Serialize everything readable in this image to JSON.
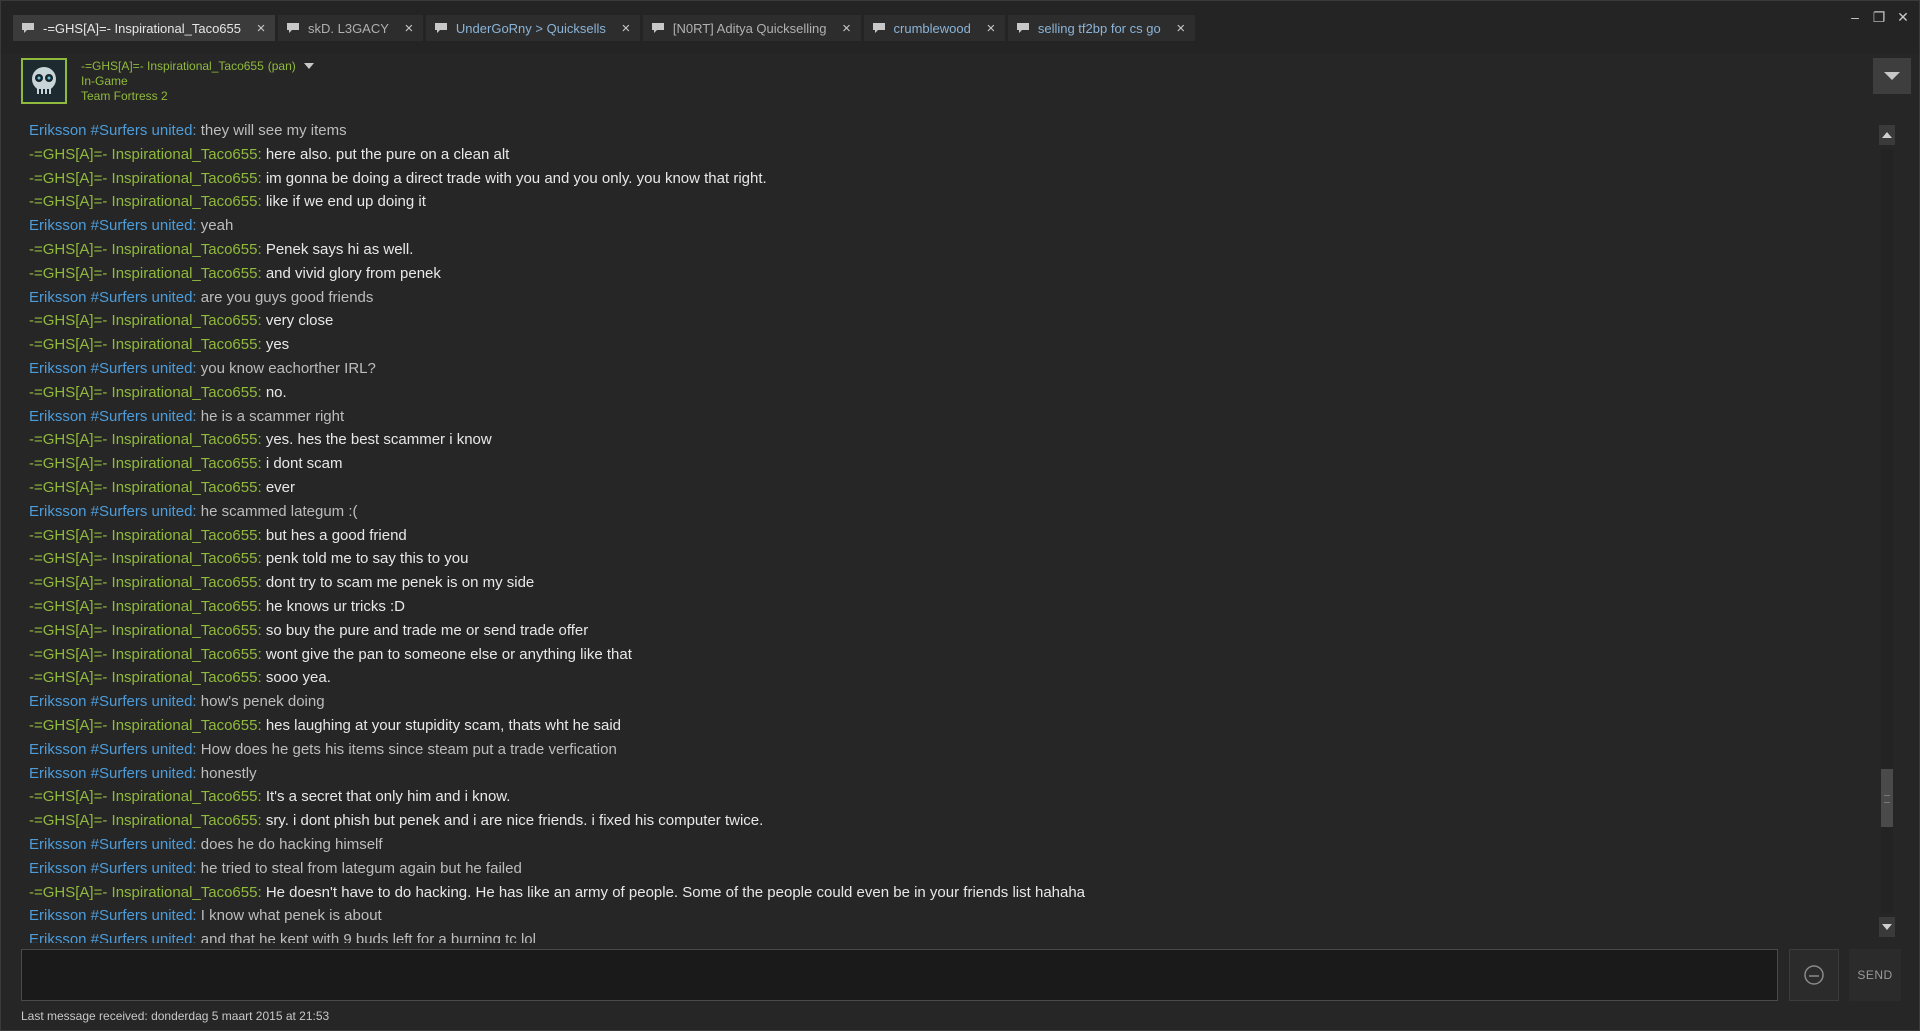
{
  "tabs": [
    {
      "label": "-=GHS[A]=- Inspirational_Taco655",
      "active": true,
      "style": "active"
    },
    {
      "label": "skD. L3GACY",
      "active": false,
      "style": "plain"
    },
    {
      "label": "UnderGoRny > Quicksells",
      "active": false,
      "style": "link"
    },
    {
      "label": "[N0RT] Aditya Quickselling",
      "active": false,
      "style": "plain"
    },
    {
      "label": "crumblewood",
      "active": false,
      "style": "link"
    },
    {
      "label": "selling tf2bp for cs go",
      "active": false,
      "style": "link"
    }
  ],
  "tab_close_glyph": "×",
  "window_controls": {
    "minimize": "–",
    "restore": "❐",
    "close": "✕"
  },
  "header": {
    "name": "-=GHS[A]=- Inspirational_Taco655",
    "name_suffix": "(pan)",
    "status": "In-Game",
    "game": "Team Fortress 2"
  },
  "colors": {
    "friend_name": "#4d9ddb",
    "self_name": "#90ba3c",
    "background": "#262626"
  },
  "messages": [
    {
      "from": "them",
      "sender": "Eriksson #Surfers united",
      "text": "they will see my items"
    },
    {
      "from": "me",
      "sender": "-=GHS[A]=- Inspirational_Taco655",
      "text": "here also. put the pure on a clean alt"
    },
    {
      "from": "me",
      "sender": "-=GHS[A]=- Inspirational_Taco655",
      "text": "im gonna be doing a direct trade with you and you only. you know that right."
    },
    {
      "from": "me",
      "sender": "-=GHS[A]=- Inspirational_Taco655",
      "text": "like if we end up doing it"
    },
    {
      "from": "them",
      "sender": "Eriksson #Surfers united",
      "text": "yeah"
    },
    {
      "from": "me",
      "sender": "-=GHS[A]=- Inspirational_Taco655",
      "text": "Penek says hi as well."
    },
    {
      "from": "me",
      "sender": "-=GHS[A]=- Inspirational_Taco655",
      "text": "and vivid glory from penek"
    },
    {
      "from": "them",
      "sender": "Eriksson #Surfers united",
      "text": "are you guys good friends"
    },
    {
      "from": "me",
      "sender": "-=GHS[A]=- Inspirational_Taco655",
      "text": "very close"
    },
    {
      "from": "me",
      "sender": "-=GHS[A]=- Inspirational_Taco655",
      "text": "yes"
    },
    {
      "from": "them",
      "sender": "Eriksson #Surfers united",
      "text": "you know eachorther IRL?"
    },
    {
      "from": "me",
      "sender": "-=GHS[A]=- Inspirational_Taco655",
      "text": "no."
    },
    {
      "from": "them",
      "sender": "Eriksson #Surfers united",
      "text": "he is a scammer right"
    },
    {
      "from": "me",
      "sender": "-=GHS[A]=- Inspirational_Taco655",
      "text": "yes. hes the best scammer i know"
    },
    {
      "from": "me",
      "sender": "-=GHS[A]=- Inspirational_Taco655",
      "text": "i dont scam"
    },
    {
      "from": "me",
      "sender": "-=GHS[A]=- Inspirational_Taco655",
      "text": "ever"
    },
    {
      "from": "them",
      "sender": "Eriksson #Surfers united",
      "text": "he scammed lategum :("
    },
    {
      "from": "me",
      "sender": "-=GHS[A]=- Inspirational_Taco655",
      "text": "but hes a good friend"
    },
    {
      "from": "me",
      "sender": "-=GHS[A]=- Inspirational_Taco655",
      "text": "penk told me to say this to you"
    },
    {
      "from": "me",
      "sender": "-=GHS[A]=- Inspirational_Taco655",
      "text": "dont try to scam me penek is on my side"
    },
    {
      "from": "me",
      "sender": "-=GHS[A]=- Inspirational_Taco655",
      "text": "he knows ur tricks :D"
    },
    {
      "from": "me",
      "sender": "-=GHS[A]=- Inspirational_Taco655",
      "text": "so buy the pure and trade me or send trade offer"
    },
    {
      "from": "me",
      "sender": "-=GHS[A]=- Inspirational_Taco655",
      "text": "wont give the pan to someone else or anything like that"
    },
    {
      "from": "me",
      "sender": "-=GHS[A]=- Inspirational_Taco655",
      "text": "sooo yea."
    },
    {
      "from": "them",
      "sender": "Eriksson #Surfers united",
      "text": "how's penek doing"
    },
    {
      "from": "me",
      "sender": "-=GHS[A]=- Inspirational_Taco655",
      "text": "hes laughing at your stupidity scam, thats wht he said"
    },
    {
      "from": "them",
      "sender": "Eriksson #Surfers united",
      "text": "How does he gets his items since steam put a trade verfication"
    },
    {
      "from": "them",
      "sender": "Eriksson #Surfers united",
      "text": "honestly"
    },
    {
      "from": "me",
      "sender": "-=GHS[A]=- Inspirational_Taco655",
      "text": "It's a secret that only him and i know."
    },
    {
      "from": "me",
      "sender": "-=GHS[A]=- Inspirational_Taco655",
      "text": "sry. i dont phish but penek and i are nice friends. i fixed his computer twice."
    },
    {
      "from": "them",
      "sender": "Eriksson #Surfers united",
      "text": "does he do hacking himself"
    },
    {
      "from": "them",
      "sender": "Eriksson #Surfers united",
      "text": "he tried to steal from lategum again but he failed"
    },
    {
      "from": "me",
      "sender": "-=GHS[A]=- Inspirational_Taco655",
      "text": "He doesn't have to do hacking. He has like an army of people. Some of the people could even be in your friends list hahaha"
    },
    {
      "from": "them",
      "sender": "Eriksson #Surfers united",
      "text": "I know what penek is about"
    },
    {
      "from": "them",
      "sender": "Eriksson #Surfers united",
      "text": "and that he kept with 9 buds left for a burning tc lol"
    }
  ],
  "input": {
    "value": "",
    "placeholder": ""
  },
  "buttons": {
    "send_label": "SEND"
  },
  "footer": {
    "last_message": "Last message received: donderdag 5 maart 2015 at 21:53"
  },
  "scroll": {
    "position_fraction": 0.82
  }
}
